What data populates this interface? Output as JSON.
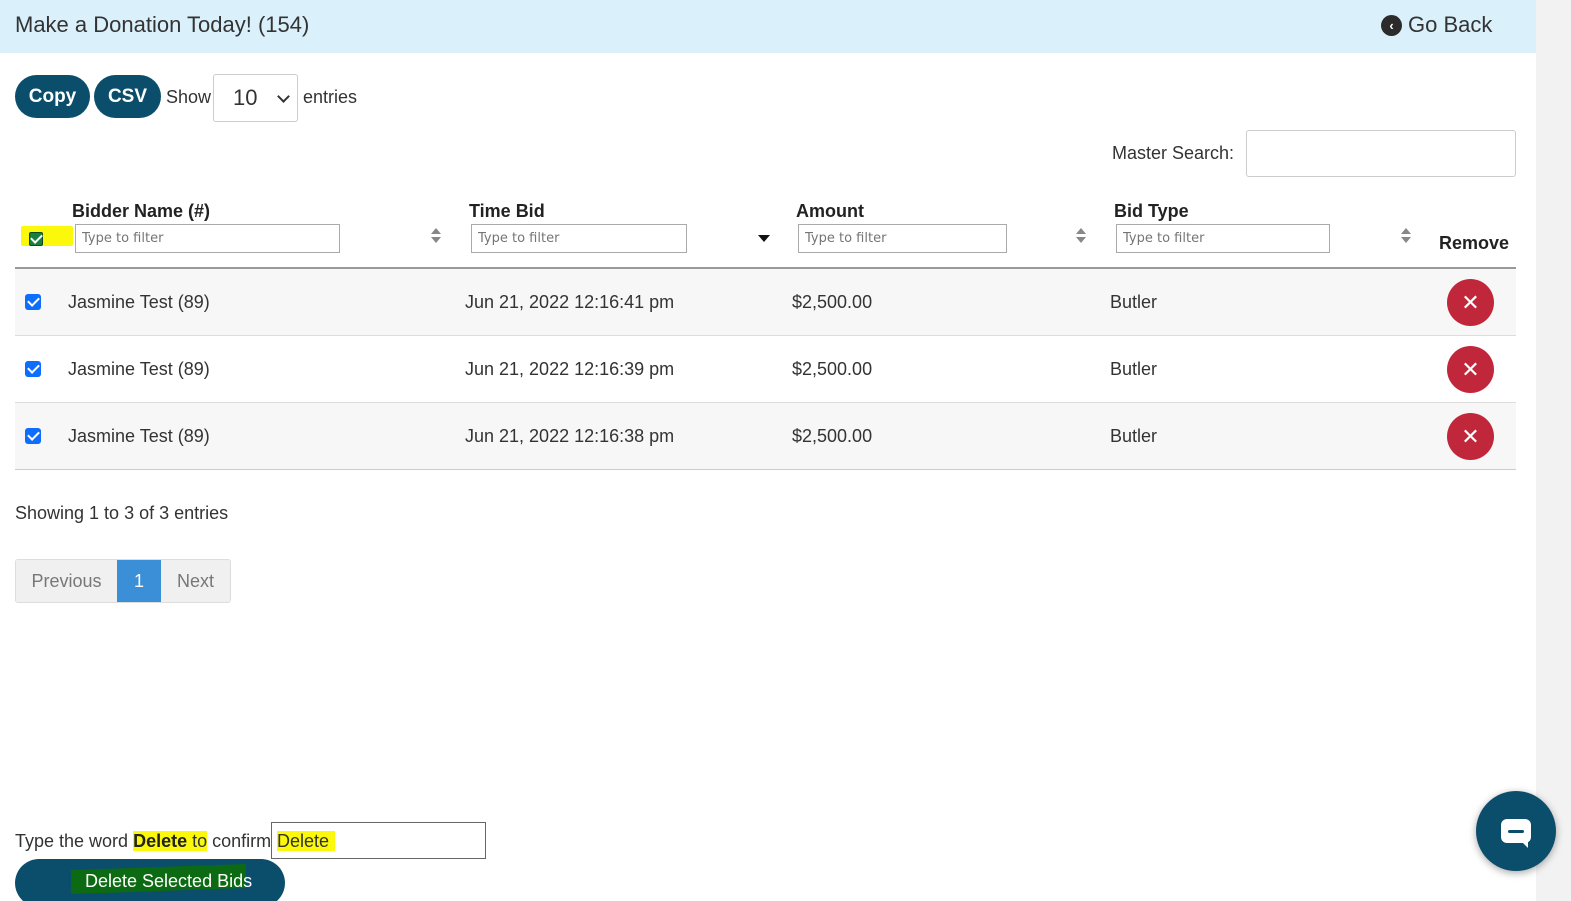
{
  "header": {
    "title": "Make a Donation Today! (154)",
    "go_back_label": "Go Back"
  },
  "toolbar": {
    "copy_label": "Copy",
    "csv_label": "CSV",
    "show_label": "Show",
    "entries_value": "10",
    "entries_label": "entries"
  },
  "search": {
    "master_label": "Master Search:",
    "master_value": ""
  },
  "table": {
    "columns": [
      {
        "label": "Bidder Name (#)",
        "filter_placeholder": "Type to filter"
      },
      {
        "label": "Time Bid",
        "filter_placeholder": "Type to filter"
      },
      {
        "label": "Amount",
        "filter_placeholder": "Type to filter"
      },
      {
        "label": "Bid Type",
        "filter_placeholder": "Type to filter"
      },
      {
        "label": "Remove"
      }
    ],
    "rows": [
      {
        "bidder": "Jasmine Test (89)",
        "time": "Jun 21, 2022 12:16:41 pm",
        "amount": "$2,500.00",
        "type": "Butler"
      },
      {
        "bidder": "Jasmine Test (89)",
        "time": "Jun 21, 2022 12:16:39 pm",
        "amount": "$2,500.00",
        "type": "Butler"
      },
      {
        "bidder": "Jasmine Test (89)",
        "time": "Jun 21, 2022 12:16:38 pm",
        "amount": "$2,500.00",
        "type": "Butler"
      }
    ],
    "remove_glyph": "✕"
  },
  "footer": {
    "showing": "Showing 1 to 3 of 3 entries",
    "prev_label": "Previous",
    "page": "1",
    "next_label": "Next"
  },
  "confirm": {
    "prefix": "Type the word ",
    "keyword": "Delete",
    "mid": " to",
    "suffix": " confirm.",
    "input_value": "Delete",
    "delete_button_label": "Delete Selected Bids"
  },
  "colors": {
    "primary": "#0b4e6b",
    "danger": "#c1273a",
    "highlight": "#fbf80b",
    "header_bg": "#daf0fb",
    "page_active": "#3a8fd6"
  },
  "icons": {
    "go_back": "chevron-left-circle-icon",
    "remove": "close-icon",
    "chat": "chat-bubble-icon"
  }
}
